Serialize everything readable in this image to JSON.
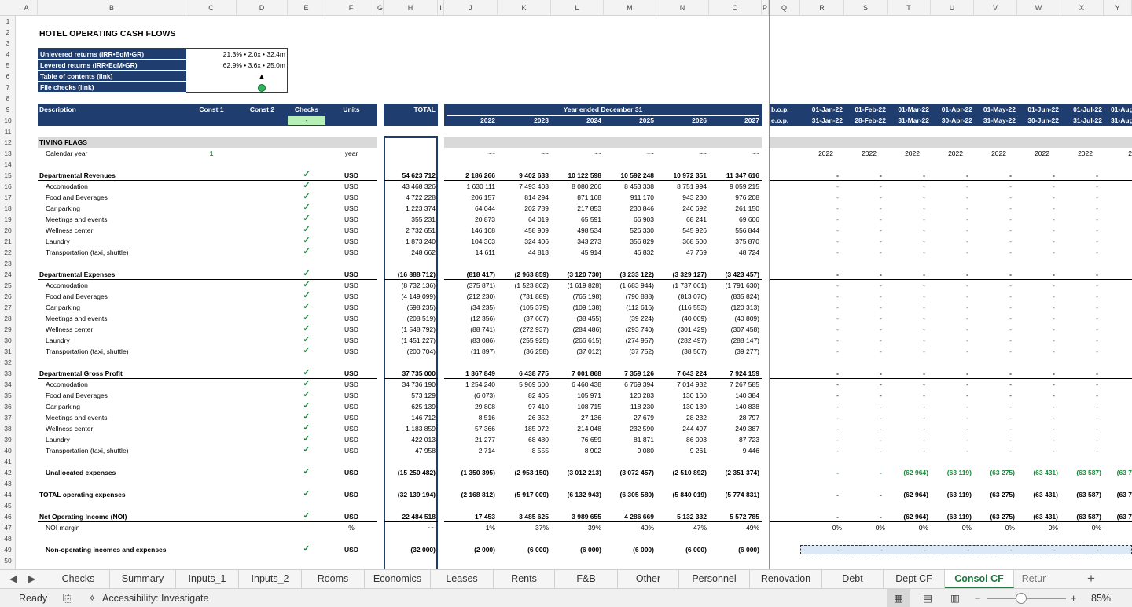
{
  "columns": [
    "A",
    "B",
    "C",
    "D",
    "E",
    "F",
    "G",
    "H",
    "I",
    "J",
    "K",
    "L",
    "M",
    "N",
    "O",
    "P",
    "Q",
    "R",
    "S",
    "T",
    "U",
    "V",
    "W",
    "X",
    "Y"
  ],
  "title": "HOTEL OPERATING CASH FLOWS",
  "summary_box": [
    {
      "label": "Unlevered returns (IRR•EqM•GR)",
      "value": "21.3% • 2.0x • 32.4m"
    },
    {
      "label": "Levered returns (IRR•EqM•GR)",
      "value": "62.9% • 3.6x • 25.0m"
    },
    {
      "label": "Table of contents (link)",
      "value": "▲"
    },
    {
      "label": "File checks (link)",
      "value": "●"
    }
  ],
  "header": {
    "description": "Description",
    "const1": "Const 1",
    "const2": "Const 2",
    "checks": "Checks",
    "checks_value": "-",
    "units": "Units",
    "total": "TOTAL",
    "year_ended": "Year ended December 31",
    "years": [
      "2022",
      "2023",
      "2024",
      "2025",
      "2026",
      "2027"
    ],
    "bop": "b.o.p.",
    "eop": "e.o.p.",
    "month_start": [
      "01-Jan-22",
      "01-Feb-22",
      "01-Mar-22",
      "01-Apr-22",
      "01-May-22",
      "01-Jun-22",
      "01-Jul-22",
      "01-Aug"
    ],
    "month_end": [
      "31-Jan-22",
      "28-Feb-22",
      "31-Mar-22",
      "30-Apr-22",
      "31-May-22",
      "30-Jun-22",
      "31-Jul-22",
      "31-Aug"
    ]
  },
  "timing": {
    "section": "TIMING FLAGS",
    "calendar_label": "Calendar year",
    "const1": "1",
    "units": "year",
    "annual": [
      "~~",
      "~~",
      "~~",
      "~~",
      "~~",
      "~~"
    ],
    "monthly": [
      "2022",
      "2022",
      "2022",
      "2022",
      "2022",
      "2022",
      "2022",
      "2"
    ]
  },
  "rows": [
    {
      "row": 15,
      "label": "Departmental Revenues",
      "bold": true,
      "check": true,
      "units": "USD",
      "total": "54 623 712",
      "years": [
        "2 186 266",
        "9 402 633",
        "10 122 598",
        "10 592 248",
        "10 972 351",
        "11 347 616"
      ],
      "monthly": [
        "-",
        "-",
        "-",
        "-",
        "-",
        "-",
        "-"
      ]
    },
    {
      "row": 16,
      "label": "Accomodation",
      "check": true,
      "units": "USD",
      "total": "43 468 326",
      "years": [
        "1 630 111",
        "7 493 403",
        "8 080 266",
        "8 453 338",
        "8 751 994",
        "9 059 215"
      ],
      "monthly": [
        "-",
        "-",
        "-",
        "-",
        "-",
        "-",
        "-"
      ],
      "dash_green": true
    },
    {
      "row": 17,
      "label": "Food and Beverages",
      "check": true,
      "units": "USD",
      "total": "4 722 228",
      "years": [
        "206 157",
        "814 294",
        "871 168",
        "911 170",
        "943 230",
        "976 208"
      ],
      "monthly": [
        "-",
        "-",
        "-",
        "-",
        "-",
        "-",
        "-"
      ],
      "dash_green": true
    },
    {
      "row": 18,
      "label": "Car parking",
      "check": true,
      "units": "USD",
      "total": "1 223 374",
      "years": [
        "64 044",
        "202 789",
        "217 853",
        "230 846",
        "246 692",
        "261 150"
      ],
      "monthly": [
        "-",
        "-",
        "-",
        "-",
        "-",
        "-",
        "-"
      ],
      "dash_green": true
    },
    {
      "row": 19,
      "label": "Meetings and events",
      "check": true,
      "units": "USD",
      "total": "355 231",
      "years": [
        "20 873",
        "64 019",
        "65 591",
        "66 903",
        "68 241",
        "69 606"
      ],
      "monthly": [
        "-",
        "-",
        "-",
        "-",
        "-",
        "-",
        "-"
      ],
      "dash_green": true
    },
    {
      "row": 20,
      "label": "Wellness center",
      "check": true,
      "units": "USD",
      "total": "2 732 651",
      "years": [
        "146 108",
        "458 909",
        "498 534",
        "526 330",
        "545 926",
        "556 844"
      ],
      "monthly": [
        "-",
        "-",
        "-",
        "-",
        "-",
        "-",
        "-"
      ],
      "dash_green": true
    },
    {
      "row": 21,
      "label": "Laundry",
      "check": true,
      "units": "USD",
      "total": "1 873 240",
      "years": [
        "104 363",
        "324 406",
        "343 273",
        "356 829",
        "368 500",
        "375 870"
      ],
      "monthly": [
        "-",
        "-",
        "-",
        "-",
        "-",
        "-",
        "-"
      ],
      "dash_green": true
    },
    {
      "row": 22,
      "label": "Transportation (taxi, shuttle)",
      "check": true,
      "units": "USD",
      "total": "248 662",
      "years": [
        "14 611",
        "44 813",
        "45 914",
        "46 832",
        "47 769",
        "48 724"
      ],
      "monthly": [
        "-",
        "-",
        "-",
        "-",
        "-",
        "-",
        "-"
      ],
      "dash_green": true
    },
    {
      "row": 24,
      "label": "Departmental Expenses",
      "bold": true,
      "check": true,
      "units": "USD",
      "total": "(16 888 712)",
      "years": [
        "(818 417)",
        "(2 963 859)",
        "(3 120 730)",
        "(3 233 122)",
        "(3 329 127)",
        "(3 423 457)"
      ],
      "monthly": [
        "-",
        "-",
        "-",
        "-",
        "-",
        "-",
        "-"
      ]
    },
    {
      "row": 25,
      "label": "Accomodation",
      "check": true,
      "units": "USD",
      "total": "(8 732 136)",
      "years": [
        "(375 871)",
        "(1 523 802)",
        "(1 619 828)",
        "(1 683 944)",
        "(1 737 061)",
        "(1 791 630)"
      ],
      "monthly": [
        "-",
        "-",
        "-",
        "-",
        "-",
        "-",
        "-"
      ],
      "dash_green": true
    },
    {
      "row": 26,
      "label": "Food and Beverages",
      "check": true,
      "units": "USD",
      "total": "(4 149 099)",
      "years": [
        "(212 230)",
        "(731 889)",
        "(765 198)",
        "(790 888)",
        "(813 070)",
        "(835 824)"
      ],
      "monthly": [
        "-",
        "-",
        "-",
        "-",
        "-",
        "-",
        "-"
      ],
      "dash_green": true
    },
    {
      "row": 27,
      "label": "Car parking",
      "check": true,
      "units": "USD",
      "total": "(598 235)",
      "years": [
        "(34 235)",
        "(105 379)",
        "(109 138)",
        "(112 616)",
        "(116 553)",
        "(120 313)"
      ],
      "monthly": [
        "-",
        "-",
        "-",
        "-",
        "-",
        "-",
        "-"
      ],
      "dash_green": true
    },
    {
      "row": 28,
      "label": "Meetings and events",
      "check": true,
      "units": "USD",
      "total": "(208 519)",
      "years": [
        "(12 356)",
        "(37 667)",
        "(38 455)",
        "(39 224)",
        "(40 009)",
        "(40 809)"
      ],
      "monthly": [
        "-",
        "-",
        "-",
        "-",
        "-",
        "-",
        "-"
      ],
      "dash_green": true
    },
    {
      "row": 29,
      "label": "Wellness center",
      "check": true,
      "units": "USD",
      "total": "(1 548 792)",
      "years": [
        "(88 741)",
        "(272 937)",
        "(284 486)",
        "(293 740)",
        "(301 429)",
        "(307 458)"
      ],
      "monthly": [
        "-",
        "-",
        "-",
        "-",
        "-",
        "-",
        "-"
      ],
      "dash_green": true
    },
    {
      "row": 30,
      "label": "Laundry",
      "check": true,
      "units": "USD",
      "total": "(1 451 227)",
      "years": [
        "(83 086)",
        "(255 925)",
        "(266 615)",
        "(274 957)",
        "(282 497)",
        "(288 147)"
      ],
      "monthly": [
        "-",
        "-",
        "-",
        "-",
        "-",
        "-",
        "-"
      ],
      "dash_green": true
    },
    {
      "row": 31,
      "label": "Transportation (taxi, shuttle)",
      "check": true,
      "units": "USD",
      "total": "(200 704)",
      "years": [
        "(11 897)",
        "(36 258)",
        "(37 012)",
        "(37 752)",
        "(38 507)",
        "(39 277)"
      ],
      "monthly": [
        "-",
        "-",
        "-",
        "-",
        "-",
        "-",
        "-"
      ],
      "dash_green": true
    },
    {
      "row": 33,
      "label": "Departmental Gross Profit",
      "bold": true,
      "check": true,
      "units": "USD",
      "total": "37 735 000",
      "years": [
        "1 367 849",
        "6 438 775",
        "7 001 868",
        "7 359 126",
        "7 643 224",
        "7 924 159"
      ],
      "monthly": [
        "-",
        "-",
        "-",
        "-",
        "-",
        "-",
        "-"
      ]
    },
    {
      "row": 34,
      "label": "Accomodation",
      "check": true,
      "units": "USD",
      "total": "34 736 190",
      "years": [
        "1 254 240",
        "5 969 600",
        "6 460 438",
        "6 769 394",
        "7 014 932",
        "7 267 585"
      ],
      "monthly": [
        "-",
        "-",
        "-",
        "-",
        "-",
        "-",
        "-"
      ]
    },
    {
      "row": 35,
      "label": "Food and Beverages",
      "check": true,
      "units": "USD",
      "total": "573 129",
      "years": [
        "(6 073)",
        "82 405",
        "105 971",
        "120 283",
        "130 160",
        "140 384"
      ],
      "monthly": [
        "-",
        "-",
        "-",
        "-",
        "-",
        "-",
        "-"
      ]
    },
    {
      "row": 36,
      "label": "Car parking",
      "check": true,
      "units": "USD",
      "total": "625 139",
      "years": [
        "29 808",
        "97 410",
        "108 715",
        "118 230",
        "130 139",
        "140 838"
      ],
      "monthly": [
        "-",
        "-",
        "-",
        "-",
        "-",
        "-",
        "-"
      ]
    },
    {
      "row": 37,
      "label": "Meetings and events",
      "check": true,
      "units": "USD",
      "total": "146 712",
      "years": [
        "8 516",
        "26 352",
        "27 136",
        "27 679",
        "28 232",
        "28 797"
      ],
      "monthly": [
        "-",
        "-",
        "-",
        "-",
        "-",
        "-",
        "-"
      ]
    },
    {
      "row": 38,
      "label": "Wellness center",
      "check": true,
      "units": "USD",
      "total": "1 183 859",
      "years": [
        "57 366",
        "185 972",
        "214 048",
        "232 590",
        "244 497",
        "249 387"
      ],
      "monthly": [
        "-",
        "-",
        "-",
        "-",
        "-",
        "-",
        "-"
      ]
    },
    {
      "row": 39,
      "label": "Laundry",
      "check": true,
      "units": "USD",
      "total": "422 013",
      "years": [
        "21 277",
        "68 480",
        "76 659",
        "81 871",
        "86 003",
        "87 723"
      ],
      "monthly": [
        "-",
        "-",
        "-",
        "-",
        "-",
        "-",
        "-"
      ]
    },
    {
      "row": 40,
      "label": "Transportation (taxi, shuttle)",
      "check": true,
      "units": "USD",
      "total": "47 958",
      "years": [
        "2 714",
        "8 555",
        "8 902",
        "9 080",
        "9 261",
        "9 446"
      ],
      "monthly": [
        "-",
        "-",
        "-",
        "-",
        "-",
        "-",
        "-"
      ]
    },
    {
      "row": 42,
      "label": "Unallocated expenses",
      "bold": true,
      "indent": true,
      "check": true,
      "units": "USD",
      "total": "(15 250 482)",
      "years": [
        "(1 350 395)",
        "(2 953 150)",
        "(3 012 213)",
        "(3 072 457)",
        "(2 510 892)",
        "(2 351 374)"
      ],
      "monthly": [
        "-",
        "-",
        "(62 964)",
        "(63 119)",
        "(63 275)",
        "(63 431)",
        "(63 587)",
        "(63 7"
      ],
      "monthly_green": true
    },
    {
      "row": 44,
      "label": "TOTAL operating expenses",
      "bold": true,
      "check": true,
      "units": "USD",
      "total": "(32 139 194)",
      "years": [
        "(2 168 812)",
        "(5 917 009)",
        "(6 132 943)",
        "(6 305 580)",
        "(5 840 019)",
        "(5 774 831)"
      ],
      "monthly": [
        "-",
        "-",
        "(62 964)",
        "(63 119)",
        "(63 275)",
        "(63 431)",
        "(63 587)",
        "(63 7"
      ]
    },
    {
      "row": 46,
      "label": "Net Operating Income (NOI)",
      "bold": true,
      "check": true,
      "units": "USD",
      "total": "22 484 518",
      "years": [
        "17 453",
        "3 485 625",
        "3 989 655",
        "4 286 669",
        "5 132 332",
        "5 572 785"
      ],
      "monthly": [
        "-",
        "-",
        "(62 964)",
        "(63 119)",
        "(63 275)",
        "(63 431)",
        "(63 587)",
        "(63 7"
      ]
    },
    {
      "row": 47,
      "label": "NOI margin",
      "units": "%",
      "total": "~~",
      "years": [
        "1%",
        "37%",
        "39%",
        "40%",
        "47%",
        "49%"
      ],
      "monthly": [
        "0%",
        "0%",
        "0%",
        "0%",
        "0%",
        "0%",
        "0%"
      ]
    },
    {
      "row": 49,
      "label": "Non-operating incomes and expenses",
      "bold": true,
      "indent": true,
      "check": true,
      "units": "USD",
      "total": "(32 000)",
      "years": [
        "(2 000)",
        "(6 000)",
        "(6 000)",
        "(6 000)",
        "(6 000)",
        "(6 000)"
      ],
      "monthly": []
    }
  ],
  "tabs": [
    "Checks",
    "Summary",
    "Inputs_1",
    "Inputs_2",
    "Rooms",
    "Economics",
    "Leases",
    "Rents",
    "F&B",
    "Other",
    "Personnel",
    "Renovation",
    "Debt",
    "Dept CF",
    "Consol CF",
    "Retur"
  ],
  "active_tab": "Consol CF",
  "status": {
    "ready": "Ready",
    "accessibility": "Accessibility: Investigate",
    "zoom": "85%"
  }
}
